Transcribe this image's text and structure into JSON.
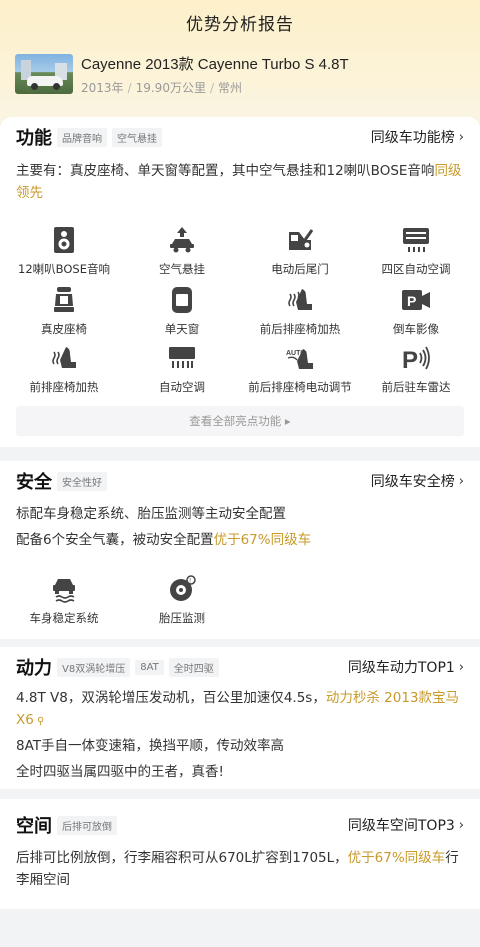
{
  "page": {
    "title": "优势分析报告"
  },
  "car": {
    "name": "Cayenne 2013款 Cayenne Turbo S 4.8T",
    "year": "2013年",
    "mileage": "19.90万公里",
    "city": "常州",
    "sep": "/"
  },
  "features": {
    "title": "功能",
    "tags": [
      "品牌音响",
      "空气悬挂"
    ],
    "rank_label": "同级车功能榜",
    "desc_plain": "主要有：真皮座椅、单天窗等配置，其中空气悬挂和12喇叭BOSE音响",
    "desc_highlight": "同级领先",
    "items": [
      {
        "label": "12喇叭BOSE音响",
        "icon": "speaker-icon"
      },
      {
        "label": "空气悬挂",
        "icon": "air-suspension-icon"
      },
      {
        "label": "电动后尾门",
        "icon": "power-tailgate-icon"
      },
      {
        "label": "四区自动空调",
        "icon": "climate-four-zone-icon"
      },
      {
        "label": "真皮座椅",
        "icon": "leather-seat-icon"
      },
      {
        "label": "单天窗",
        "icon": "sunroof-icon"
      },
      {
        "label": "前后排座椅加热",
        "icon": "seat-heating-icon"
      },
      {
        "label": "倒车影像",
        "icon": "rear-camera-icon"
      },
      {
        "label": "前排座椅加热",
        "icon": "front-seat-heating-icon"
      },
      {
        "label": "自动空调",
        "icon": "auto-ac-icon"
      },
      {
        "label": "前后排座椅电动调节",
        "icon": "power-seat-icon"
      },
      {
        "label": "前后驻车雷达",
        "icon": "parking-radar-icon"
      }
    ],
    "more_label": "查看全部亮点功能 ▸"
  },
  "safety": {
    "title": "安全",
    "tags": [
      "安全性好"
    ],
    "rank_label": "同级车安全榜",
    "line1": "标配车身稳定系统、胎压监测等主动安全配置",
    "line2_plain": "配备6个安全气囊，被动安全配置",
    "line2_highlight": "优于67%同级车",
    "items": [
      {
        "label": "车身稳定系统",
        "icon": "stability-control-icon"
      },
      {
        "label": "胎压监测",
        "icon": "tire-pressure-icon"
      }
    ]
  },
  "power": {
    "title": "动力",
    "tags": [
      "V8双涡轮增压",
      "8AT",
      "全时四驱"
    ],
    "rank_label": "同级车动力TOP1",
    "line1_plain": "4.8T V8，双涡轮增压发动机，百公里加速仅4.5s，",
    "line1_highlight": "动力秒杀 2013款宝马X6",
    "line2": "8AT手自一体变速箱，换挡平顺，传动效率高",
    "line3": "全时四驱当属四驱中的王者，真香!"
  },
  "space": {
    "title": "空间",
    "tags": [
      "后排可放倒"
    ],
    "rank_label": "同级车空间TOP3",
    "line1_plain": "后排可比例放倒，行李厢容积可从670L扩容到1705L，",
    "line1_highlight": "优于67%同级车",
    "line1_tail": "行李厢空间"
  },
  "colors": {
    "accent": "#c79a2a",
    "hero_top": "#fdf0c9",
    "background": "#f2f3f5"
  }
}
